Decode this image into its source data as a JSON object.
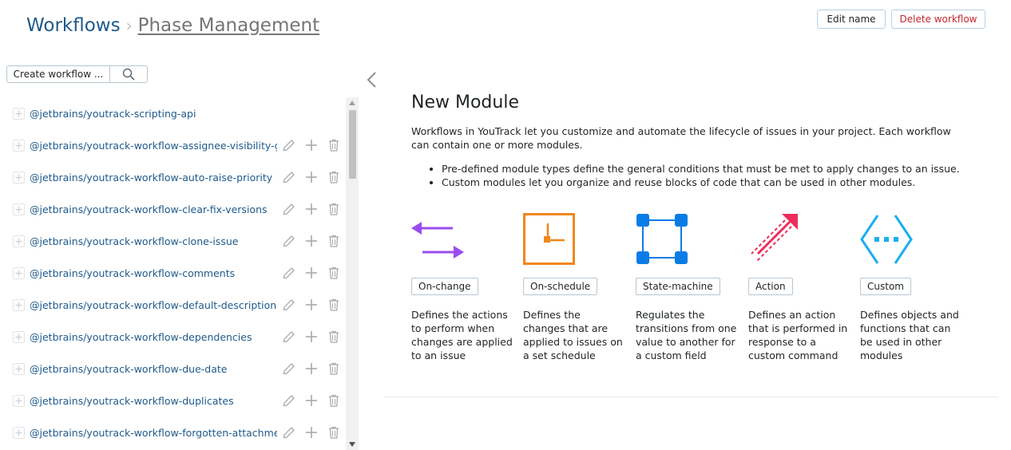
{
  "breadcrumb": {
    "root": "Workflows",
    "separator": "›",
    "current": "Phase Management"
  },
  "header_actions": {
    "edit_name": "Edit name",
    "delete_workflow": "Delete workflow"
  },
  "sidebar": {
    "create_label": "Create workflow ...",
    "search_icon": "search-icon",
    "workflows": [
      {
        "name": "@jetbrains/youtrack-scripting-api",
        "has_actions": false
      },
      {
        "name": "@jetbrains/youtrack-workflow-assignee-visibility-group",
        "has_actions": true
      },
      {
        "name": "@jetbrains/youtrack-workflow-auto-raise-priority",
        "has_actions": true
      },
      {
        "name": "@jetbrains/youtrack-workflow-clear-fix-versions",
        "has_actions": true
      },
      {
        "name": "@jetbrains/youtrack-workflow-clone-issue",
        "has_actions": true
      },
      {
        "name": "@jetbrains/youtrack-workflow-comments",
        "has_actions": true
      },
      {
        "name": "@jetbrains/youtrack-workflow-default-description",
        "has_actions": true
      },
      {
        "name": "@jetbrains/youtrack-workflow-dependencies",
        "has_actions": true
      },
      {
        "name": "@jetbrains/youtrack-workflow-due-date",
        "has_actions": true
      },
      {
        "name": "@jetbrains/youtrack-workflow-duplicates",
        "has_actions": true
      },
      {
        "name": "@jetbrains/youtrack-workflow-forgotten-attachment",
        "has_actions": true
      }
    ]
  },
  "main": {
    "title": "New Module",
    "intro": "Workflows in YouTrack let you customize and automate the lifecycle of issues in your project. Each workflow can contain one or more modules.",
    "bullets": [
      "Pre-defined module types define the general conditions that must be met to apply changes to an issue.",
      "Custom modules let you organize and reuse blocks of code that can be used in other modules."
    ],
    "modules": [
      {
        "icon": "on-change-icon",
        "label": "On-change",
        "description": "Defines the actions to perform when changes are applied to an issue",
        "color": "#9a4cf2"
      },
      {
        "icon": "on-schedule-icon",
        "label": "On-schedule",
        "description": "Defines the changes that are applied to issues on a set schedule",
        "color": "#f0861d"
      },
      {
        "icon": "state-machine-icon",
        "label": "State-machine",
        "description": "Regulates the transitions from one value to another for a custom field",
        "color": "#0a7ce6"
      },
      {
        "icon": "action-icon",
        "label": "Action",
        "description": "Defines an action that is performed in response to a custom command",
        "color": "#ec2d5b"
      },
      {
        "icon": "custom-icon",
        "label": "Custom",
        "description": "Defines objects and functions that can be used in other modules",
        "color": "#1aaef0"
      }
    ]
  },
  "colors": {
    "link": "#1f5a8a",
    "danger": "#c22731",
    "border": "#b8c6d2"
  }
}
